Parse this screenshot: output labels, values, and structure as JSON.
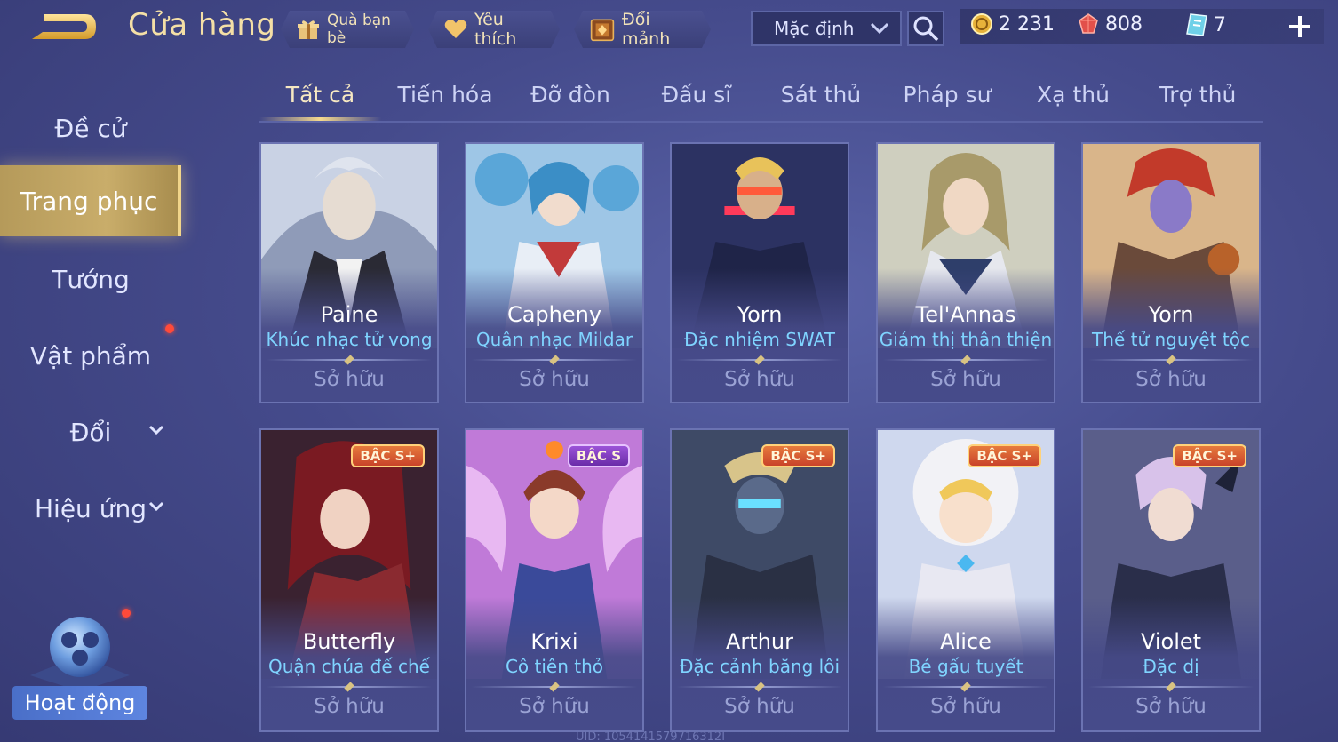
{
  "header": {
    "title": "Cửa hàng",
    "buttons": [
      {
        "label": "Quà bạn bè",
        "icon": "gift-icon"
      },
      {
        "label": "Yêu thích",
        "icon": "heart-icon"
      },
      {
        "label": "Đổi mảnh",
        "icon": "shard-chest-icon"
      }
    ],
    "sort": {
      "value": "Mặc định"
    },
    "currencies": [
      {
        "icon": "gold-coin-icon",
        "value": "2 231"
      },
      {
        "icon": "ruby-gem-icon",
        "value": "808"
      },
      {
        "icon": "voucher-card-icon",
        "value": "7"
      }
    ]
  },
  "sidebar": {
    "items": [
      {
        "label": "Đề cử",
        "active": false
      },
      {
        "label": "Trang phục",
        "active": true
      },
      {
        "label": "Tướng",
        "active": false
      },
      {
        "label": "Vật phẩm",
        "active": false,
        "notification": true
      },
      {
        "label": "Đổi",
        "active": false,
        "expandable": true
      },
      {
        "label": "Hiệu ứng",
        "active": false,
        "expandable": true
      }
    ],
    "activity": {
      "label": "Hoạt động"
    }
  },
  "tabs": [
    "Tất cả",
    "Tiến hóa",
    "Đỡ đòn",
    "Đấu sĩ",
    "Sát thủ",
    "Pháp sư",
    "Xạ thủ",
    "Trợ thủ"
  ],
  "active_tab": 0,
  "cards": [
    {
      "hero": "Paine",
      "skin": "Khúc nhạc tử vong",
      "status": "Sở hữu",
      "badge": ""
    },
    {
      "hero": "Capheny",
      "skin": "Quân nhạc Mildar",
      "status": "Sở hữu",
      "badge": ""
    },
    {
      "hero": "Yorn",
      "skin": "Đặc nhiệm SWAT",
      "status": "Sở hữu",
      "badge": ""
    },
    {
      "hero": "Tel'Annas",
      "skin": "Giám thị thân thiện",
      "status": "Sở hữu",
      "badge": ""
    },
    {
      "hero": "Yorn",
      "skin": "Thế tử nguyệt tộc",
      "status": "Sở hữu",
      "badge": ""
    },
    {
      "hero": "Butterfly",
      "skin": "Quận chúa đế chế",
      "status": "Sở hữu",
      "badge": "BẬC S+"
    },
    {
      "hero": "Krixi",
      "skin": "Cô tiên thỏ",
      "status": "Sở hữu",
      "badge": "BẬC S"
    },
    {
      "hero": "Arthur",
      "skin": "Đặc cảnh băng lôi",
      "status": "Sở hữu",
      "badge": "BẬC S+"
    },
    {
      "hero": "Alice",
      "skin": "Bé gấu tuyết",
      "status": "Sở hữu",
      "badge": "BẬC S+"
    },
    {
      "hero": "Violet",
      "skin": "Đặc dị",
      "status": "Sở hữu",
      "badge": "BẬC S+"
    }
  ],
  "footer": {
    "uid": "UID: 1054141579716312I"
  },
  "colors": {
    "accent_gold": "#f4dfa6",
    "skin_name": "#7fd4ff",
    "panel": "#454a88"
  }
}
